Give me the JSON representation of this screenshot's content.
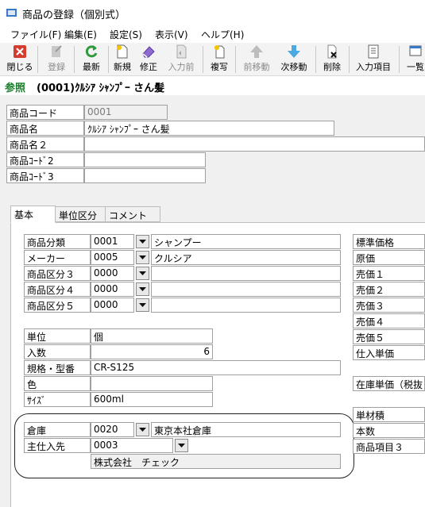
{
  "window": {
    "title": "商品の登録（個別式）"
  },
  "menu": [
    "ファイル(F)",
    "編集(E)",
    "設定(S)",
    "表示(V)",
    "ヘルプ(H)"
  ],
  "toolbar": {
    "close": "閉じる",
    "register": "登録",
    "refresh": "最新",
    "new": "新規",
    "modify": "修正",
    "input_prev": "入力前",
    "copy": "複写",
    "prev_move": "前移動",
    "next_move": "次移動",
    "delete": "削除",
    "input_items": "入力項目",
    "list": "一覧"
  },
  "mode": {
    "label": "参照",
    "record": "(0001)ｸﾙｼｱ ｼｬﾝﾌﾟｰ さん髪"
  },
  "header": {
    "code_label": "商品コード",
    "code_value": "0001",
    "name_label": "商品名",
    "name_value": "ｸﾙｼｱ ｼｬﾝﾌﾟｰ さん髪",
    "name2_label": "商品名２",
    "name2_value": "",
    "code2_label": "商品ｺｰﾄﾞ2",
    "code2_value": "",
    "code3_label": "商品ｺｰﾄﾞ3",
    "code3_value": ""
  },
  "tabs": [
    "基本",
    "単位区分",
    "コメント"
  ],
  "classify": {
    "rows": [
      {
        "label": "商品分類",
        "code": "0001",
        "name": "シャンプー"
      },
      {
        "label": "メーカー",
        "code": "0005",
        "name": "クルシア"
      },
      {
        "label": "商品区分３",
        "code": "0000",
        "name": ""
      },
      {
        "label": "商品区分４",
        "code": "0000",
        "name": ""
      },
      {
        "label": "商品区分５",
        "code": "0000",
        "name": ""
      }
    ]
  },
  "unit": {
    "unit_label": "単位",
    "unit_value": "個",
    "qty_label": "入数",
    "qty_value": "6",
    "spec_label": "規格・型番",
    "spec_value": "CR-S125",
    "color_label": "色",
    "color_value": "",
    "size_label": "ｻｲｽﾞ",
    "size_value": "600ml"
  },
  "warehouse": {
    "wh_label": "倉庫",
    "wh_code": "0020",
    "wh_name": "東京本社倉庫",
    "supplier_label": "主仕入先",
    "supplier_code": "0003",
    "supplier_name": "株式会社　チェック"
  },
  "prices": [
    "標準価格",
    "原価",
    "売価１",
    "売価２",
    "売価３",
    "売価４",
    "売価５",
    "仕入単価"
  ],
  "stock_unit_label": "在庫単価（税抜",
  "extra": [
    "単材積",
    "本数",
    "商品項目３"
  ]
}
